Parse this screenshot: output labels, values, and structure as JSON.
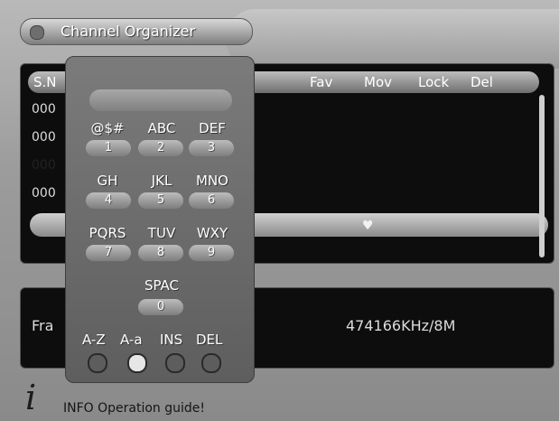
{
  "window": {
    "title": "Channel Organizer"
  },
  "list": {
    "headers": {
      "sn": "S.N",
      "fav": "Fav",
      "mov": "Mov",
      "lock": "Lock",
      "del": "Del"
    },
    "rows": [
      "000",
      "000",
      "000",
      "000"
    ],
    "selected_row_index": 2,
    "fav_marker": "♥"
  },
  "info": {
    "label": "Fra",
    "value": "474166KHz/8M"
  },
  "keypad": {
    "input_value": "",
    "keys": [
      {
        "label": "@$#",
        "digit": "1"
      },
      {
        "label": "ABC",
        "digit": "2"
      },
      {
        "label": "DEF",
        "digit": "3"
      },
      {
        "label": "GH",
        "digit": "4"
      },
      {
        "label": "JKL",
        "digit": "5"
      },
      {
        "label": "MNO",
        "digit": "6"
      },
      {
        "label": "PQRS",
        "digit": "7"
      },
      {
        "label": "TUV",
        "digit": "8"
      },
      {
        "label": "WXY",
        "digit": "9"
      },
      {
        "label": "SPAC",
        "digit": "0"
      }
    ],
    "modes": [
      "A-Z",
      "A-a",
      "INS",
      "DEL"
    ],
    "active_mode_index": 1
  },
  "help": {
    "icon": "info-icon",
    "icon_glyph": "i",
    "text": "INFO Operation guide!"
  }
}
